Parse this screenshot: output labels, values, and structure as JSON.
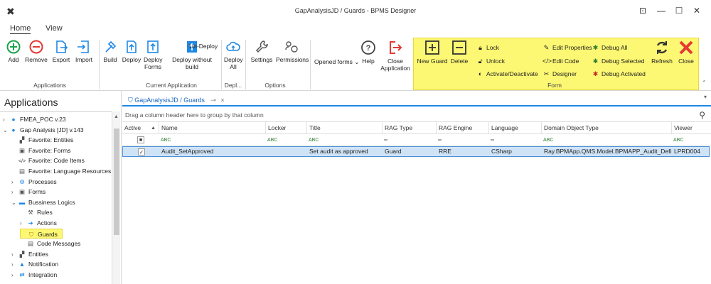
{
  "window": {
    "title": "GapAnalysisJD / Guards - BPMS Designer"
  },
  "ribbon_tabs": [
    "Home",
    "View"
  ],
  "ribbon": {
    "applications": {
      "label": "Applications",
      "add": "Add",
      "remove": "Remove",
      "export": "Export",
      "import": "Import"
    },
    "current_application": {
      "label": "Current Application",
      "build": "Build",
      "deploy": "Deploy",
      "deploy_forms": "Deploy Forms",
      "undeploy": "Un-Deploy",
      "deploy_without_build": "Deploy without build"
    },
    "depl": {
      "label": "Depl...",
      "deploy_all": "Deploy All"
    },
    "options": {
      "label": "Options",
      "settings": "Settings",
      "permissions": "Permissions"
    },
    "opened_forms": "Opened forms",
    "help": "Help",
    "close_application": "Close Application",
    "form": {
      "label": "Form",
      "new_guard": "New Guard",
      "delete": "Delete",
      "lock": "Lock",
      "unlock": "Unlock",
      "activate_deactivate": "Activate/Deactivate",
      "edit_properties": "Edit Properties",
      "edit_code": "Edit Code",
      "designer": "Designer",
      "debug_all": "Debug All",
      "debug_selected": "Debug Selected",
      "debug_activated": "Debug Activated",
      "refresh": "Refresh",
      "close": "Close"
    }
  },
  "left_panel": {
    "title": "Applications",
    "tree": [
      {
        "label": "FMEA_POC v.23",
        "level": 0,
        "chevron": "right",
        "icon": "circle-icon"
      },
      {
        "label": "Gap Analysis [JD] v.143",
        "level": 0,
        "chevron": "down",
        "icon": "circle-icon"
      },
      {
        "label": "Favorite: Entities",
        "level": 1,
        "chevron": "",
        "icon": "entities-icon"
      },
      {
        "label": "Favorite: Forms",
        "level": 1,
        "chevron": "",
        "icon": "forms-icon"
      },
      {
        "label": "Favorite: Code Items",
        "level": 1,
        "chevron": "",
        "icon": "code-icon"
      },
      {
        "label": "Favorite: Language Resources",
        "level": 1,
        "chevron": "",
        "icon": "language-icon"
      },
      {
        "label": "Processes",
        "level": 1,
        "chevron": "right",
        "icon": "gears-icon"
      },
      {
        "label": "Forms",
        "level": 1,
        "chevron": "right",
        "icon": "forms-icon"
      },
      {
        "label": "Bussiness Logics",
        "level": 1,
        "chevron": "down",
        "icon": "briefcase-icon"
      },
      {
        "label": "Rules",
        "level": 2,
        "chevron": "",
        "icon": "gavel-icon"
      },
      {
        "label": "Actions",
        "level": 2,
        "chevron": "right",
        "icon": "arrow-icon"
      },
      {
        "label": "Guards",
        "level": 2,
        "chevron": "",
        "icon": "shield-icon",
        "highlighted": true
      },
      {
        "label": "Code Messages",
        "level": 2,
        "chevron": "",
        "icon": "language-icon"
      },
      {
        "label": "Entities",
        "level": 1,
        "chevron": "right",
        "icon": "entities-icon"
      },
      {
        "label": "Notification",
        "level": 1,
        "chevron": "right",
        "icon": "bell-icon"
      },
      {
        "label": "Integration",
        "level": 1,
        "chevron": "right",
        "icon": "integration-icon"
      }
    ]
  },
  "doc_tab": {
    "label": "GapAnalysisJD / Guards",
    "pin": "⊸",
    "close": "×"
  },
  "grid": {
    "group_panel_text": "Drag a column header here to group by that column",
    "columns": [
      "Active",
      "Name",
      "Locker",
      "Title",
      "RAG Type",
      "RAG Engine",
      "Language",
      "Domain Object Type",
      "Viewer"
    ],
    "filter_symbol": "ABC",
    "rows": [
      {
        "active": "✓",
        "name": "Audit_SetApproved",
        "locker": "",
        "title": "Set audit as approved",
        "rag_type": "Guard",
        "rag_engine": "RRE",
        "language": "CSharp",
        "domain_object_type": "Ray.BPMApp.QMS.Model.BPMAPP_Audit_Define...",
        "viewer": "LPRD004"
      }
    ]
  },
  "colors": {
    "highlight": "#fdf873",
    "accent": "#1e88e5",
    "add_green": "#1aa34a",
    "remove_red": "#e53935",
    "close_red": "#e53935",
    "selection": "#cfe3f7"
  }
}
